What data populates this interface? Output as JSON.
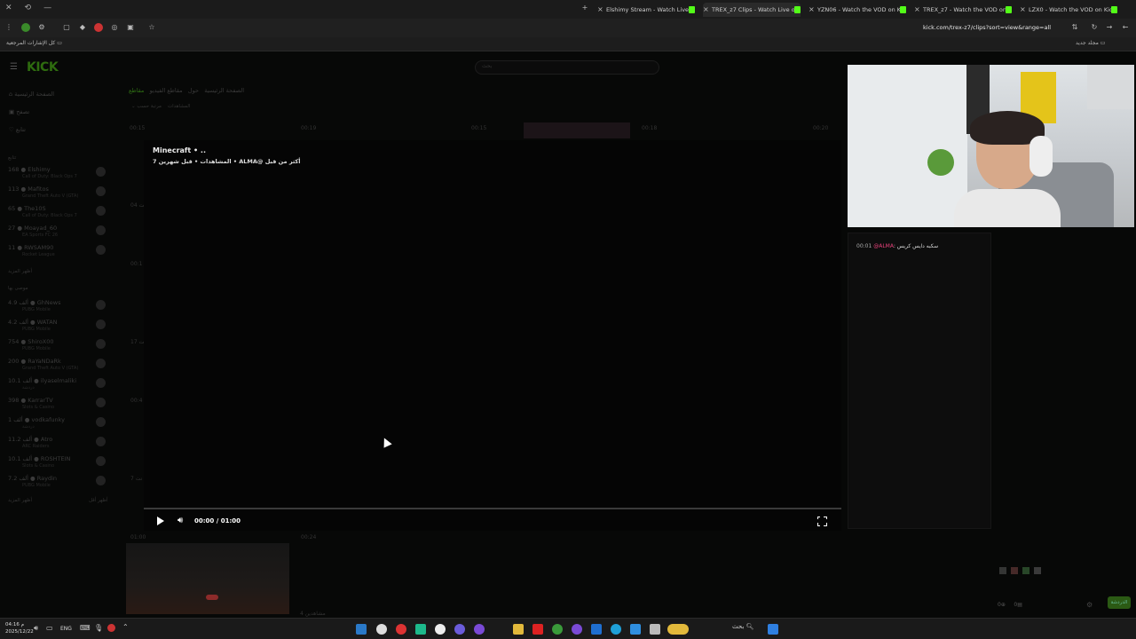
{
  "browser": {
    "tabs": [
      {
        "label": "Elshimy Stream - Watch Live on Kick",
        "active": false
      },
      {
        "label": "TREX_z7 Clips - Watch Live on Kick",
        "active": true
      },
      {
        "label": "YZN06 - Watch the VOD on Kick",
        "active": false
      },
      {
        "label": "TREX_z7 - Watch the VOD on Kick",
        "active": false
      },
      {
        "label": "LZX0 - Watch the VOD on Kick",
        "active": false
      }
    ],
    "url": "kick.com/trex-z7/clips?sort=view&range=all",
    "bookmarks_all": "كل الإشارات المرجعية",
    "bookmarks_new_folder": "مجلد جديد"
  },
  "site": {
    "logo": "KICK",
    "search_placeholder": "بحث",
    "nav": [
      "الصفحة الرئيسية",
      "تصفح",
      "تتابع"
    ],
    "following_title": "تتابع",
    "following": [
      {
        "viewers": "168",
        "name": "Elshimy",
        "category": "Call of Duty: Black Ops 7"
      },
      {
        "viewers": "113",
        "name": "Mafitos",
        "category": "Grand Theft Auto V (GTA)"
      },
      {
        "viewers": "65",
        "name": "The10S",
        "category": "Call of Duty: Black Ops 7"
      },
      {
        "viewers": "27",
        "name": "Moayad_60",
        "category": "EA Sports FC 26"
      },
      {
        "viewers": "11",
        "name": "RWSAM90",
        "category": "Rocket League"
      }
    ],
    "show_more_1": "أظهر المزيد",
    "recommended_title": "موصى بها",
    "recommended": [
      {
        "viewers": "4.9 ألف",
        "name": "GhNews",
        "category": "PUBG Mobile"
      },
      {
        "viewers": "4.2 ألف",
        "name": "WATAN",
        "category": "PUBG Mobile"
      },
      {
        "viewers": "754",
        "name": "ShiroX00",
        "category": "PUBG Mobile"
      },
      {
        "viewers": "200",
        "name": "RaYaNDaRk",
        "category": "Grand Theft Auto V (GTA)"
      },
      {
        "viewers": "10.1 ألف",
        "name": "ilyaselmaliki",
        "category": "دردشة"
      },
      {
        "viewers": "398",
        "name": "KarrarTV",
        "category": "Slots & Casino"
      },
      {
        "viewers": "1 ألف",
        "name": "vodkafunky",
        "category": "دردشة"
      },
      {
        "viewers": "11.2 ألف",
        "name": "Atro",
        "category": "ARC Raiders"
      },
      {
        "viewers": "10.1 ألف",
        "name": "ROSHTEIN",
        "category": "Slots & Casino"
      },
      {
        "viewers": "7.2 ألف",
        "name": "Raydin",
        "category": "PUBG Mobile"
      }
    ],
    "show_more_2": "أظهر المزيد",
    "show_less": "أظهر أقل",
    "channel_tabs": [
      "الصفحة الرئيسية",
      "حول",
      "مقاطع الفيديو",
      "مقاطع"
    ],
    "sort_label": "مرتبة حسب",
    "sort_value": "المشاهدات",
    "grid_times": [
      "00:15",
      "00:19",
      "00:15",
      "00:18",
      "00:20",
      "01:00",
      "00:24"
    ],
    "side_partial_labels": [
      "04 نت",
      "00:1",
      "17 نت",
      "00:4",
      "7 نت"
    ],
    "views_label": "مشاهدين 4"
  },
  "player": {
    "clip_title": "Minecraft • ..",
    "clip_meta": "المشاهدات • قبل شهرين 7 • ALMA@ أكثر من قبل",
    "timecode": "00:00 / 01:00",
    "progress": 0
  },
  "chat": {
    "message_time": "00:01",
    "message_user": "@ALMA",
    "message_text": "سكبه دايس كريس",
    "send_label": "الدردشة",
    "bottom_counts": [
      "0",
      "0"
    ]
  },
  "taskbar": {
    "lang": "ENG",
    "search_label": "بحث",
    "time": "04:16 م",
    "date": "2025/12/22"
  },
  "colors": {
    "kick_green": "#53fc18",
    "accent_pink": "#e8417a"
  }
}
